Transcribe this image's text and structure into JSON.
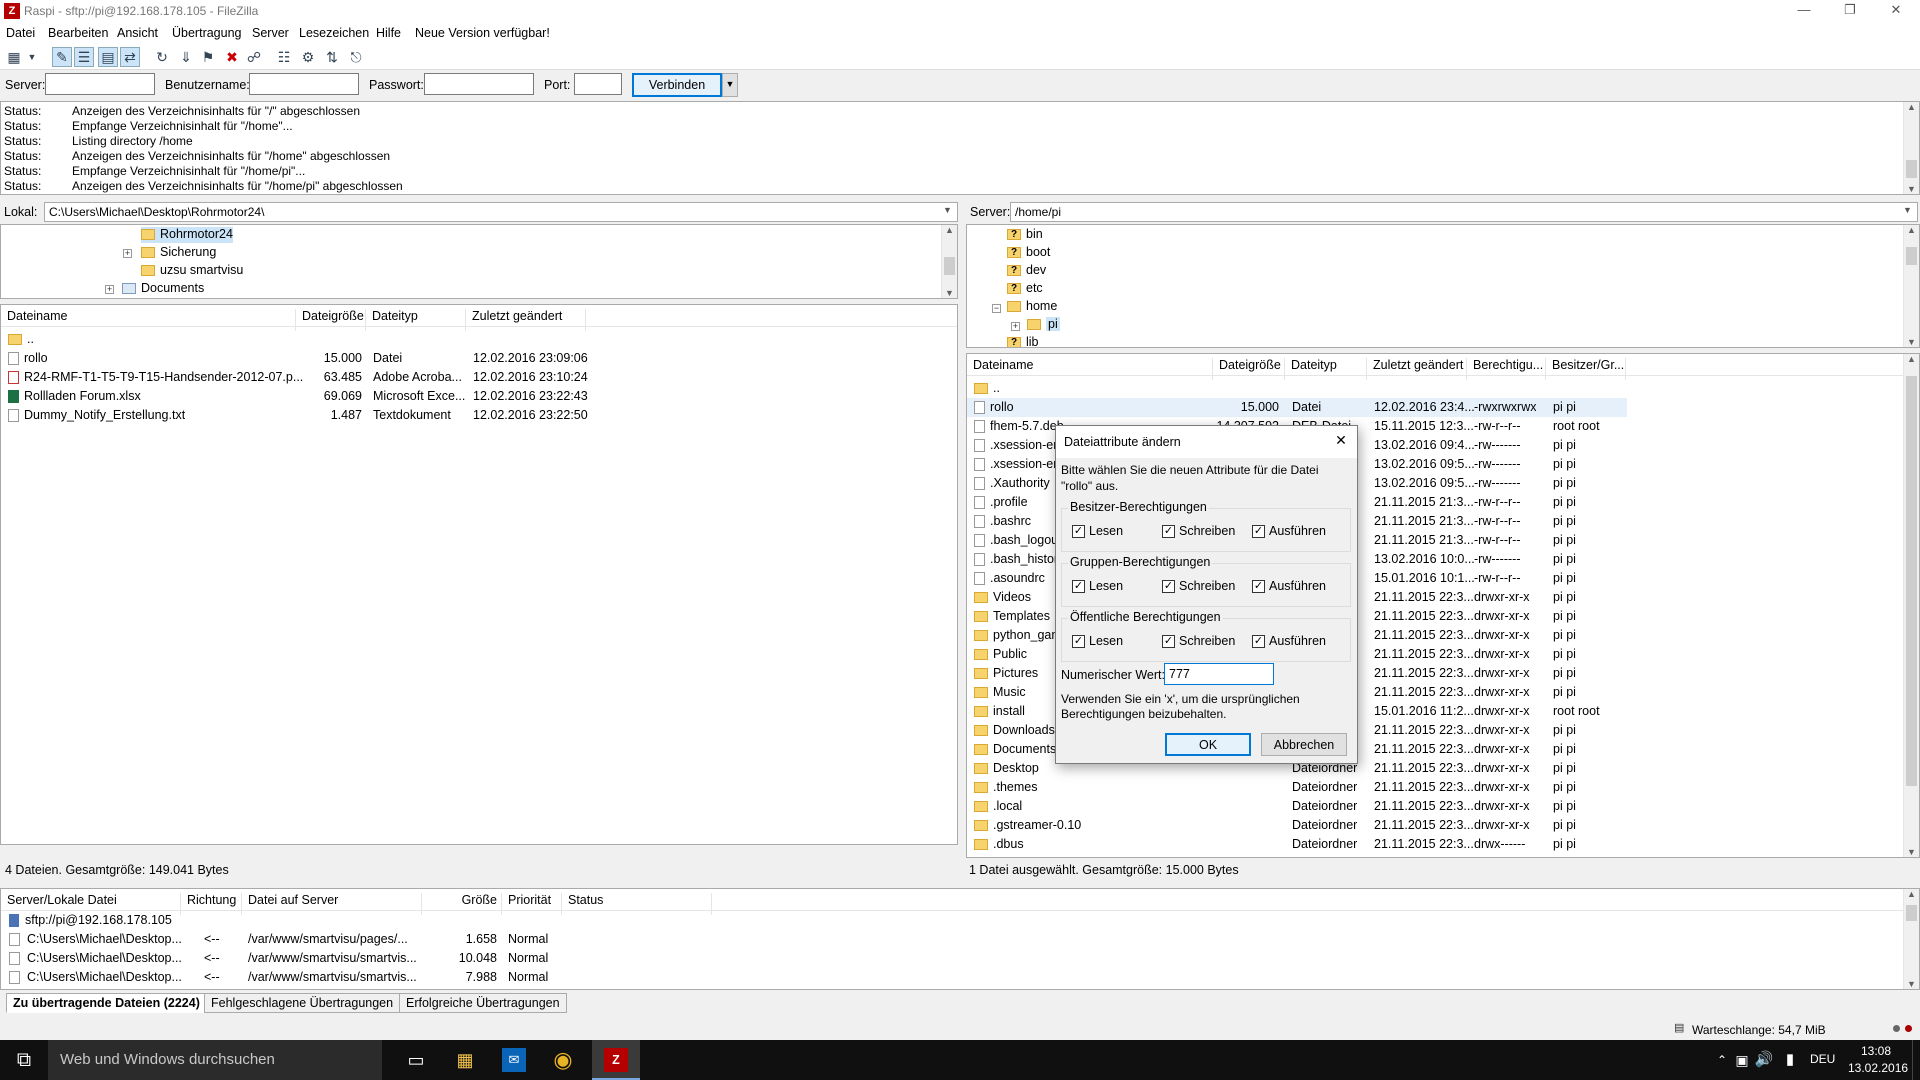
{
  "window": {
    "title": "Raspi - sftp://pi@192.168.178.105 - FileZilla",
    "app_icon": "Z"
  },
  "menu": [
    "Datei",
    "Bearbeiten",
    "Ansicht",
    "Übertragung",
    "Server",
    "Lesezeichen",
    "Hilfe",
    "Neue Version verfügbar!"
  ],
  "quickconnect": {
    "server_label": "Server:",
    "user_label": "Benutzername:",
    "pass_label": "Passwort:",
    "port_label": "Port:",
    "connect": "Verbinden",
    "server": "",
    "user": "",
    "pass": "",
    "port": ""
  },
  "log": [
    {
      "k": "Status:",
      "v": "Anzeigen des Verzeichnisinhalts für \"/\" abgeschlossen"
    },
    {
      "k": "Status:",
      "v": "Empfange Verzeichnisinhalt für \"/home\"..."
    },
    {
      "k": "Status:",
      "v": "Listing directory /home"
    },
    {
      "k": "Status:",
      "v": "Anzeigen des Verzeichnisinhalts für \"/home\" abgeschlossen"
    },
    {
      "k": "Status:",
      "v": "Empfange Verzeichnisinhalt für \"/home/pi\"..."
    },
    {
      "k": "Status:",
      "v": "Anzeigen des Verzeichnisinhalts für \"/home/pi\" abgeschlossen"
    }
  ],
  "local": {
    "label": "Lokal:",
    "path": "C:\\Users\\Michael\\Desktop\\Rohrmotor24\\",
    "tree": [
      "Rohrmotor24",
      "Sicherung",
      "uzsu smartvisu",
      "Documents"
    ],
    "headers": [
      "Dateiname",
      "Dateigröße",
      "Dateityp",
      "Zuletzt geändert"
    ],
    "files": [
      {
        "name": "..",
        "size": "",
        "type": "",
        "date": ""
      },
      {
        "name": "rollo",
        "size": "15.000",
        "type": "Datei",
        "date": "12.02.2016 23:09:06"
      },
      {
        "name": "R24-RMF-T1-T5-T9-T15-Handsender-2012-07.p...",
        "size": "63.485",
        "type": "Adobe Acroba...",
        "date": "12.02.2016 23:10:24"
      },
      {
        "name": "Rollladen Forum.xlsx",
        "size": "69.069",
        "type": "Microsoft Exce...",
        "date": "12.02.2016 23:22:43"
      },
      {
        "name": "Dummy_Notify_Erstellung.txt",
        "size": "1.487",
        "type": "Textdokument",
        "date": "12.02.2016 23:22:50"
      }
    ],
    "status": "4 Dateien. Gesamtgröße: 149.041 Bytes"
  },
  "remote": {
    "label": "Server:",
    "path": "/home/pi",
    "tree": [
      "bin",
      "boot",
      "dev",
      "etc",
      "home",
      "pi",
      "lib"
    ],
    "headers": [
      "Dateiname",
      "Dateigröße",
      "Dateityp",
      "Zuletzt geändert",
      "Berechtigu...",
      "Besitzer/Gr..."
    ],
    "files": [
      {
        "name": "..",
        "size": "",
        "type": "",
        "date": "",
        "perm": "",
        "owner": ""
      },
      {
        "name": "rollo",
        "size": "15.000",
        "type": "Datei",
        "date": "12.02.2016 23:4...",
        "perm": "-rwxrwxrwx",
        "owner": "pi pi"
      },
      {
        "name": "fhem-5.7.deb",
        "size": "14.307.592",
        "type": "DEB-Datei",
        "date": "15.11.2015 12:3...",
        "perm": "-rw-r--r--",
        "owner": "root root"
      },
      {
        "name": ".xsession-errors",
        "size": "",
        "type": "",
        "date": "13.02.2016 09:4...",
        "perm": "-rw-------",
        "owner": "pi pi"
      },
      {
        "name": ".xsession-errors",
        "size": "",
        "type": "",
        "date": "13.02.2016 09:5...",
        "perm": "-rw-------",
        "owner": "pi pi"
      },
      {
        "name": ".Xauthority",
        "size": "",
        "type": "",
        "date": "13.02.2016 09:5...",
        "perm": "-rw-------",
        "owner": "pi pi"
      },
      {
        "name": ".profile",
        "size": "",
        "type": "",
        "date": "21.11.2015 21:3...",
        "perm": "-rw-r--r--",
        "owner": "pi pi"
      },
      {
        "name": ".bashrc",
        "size": "",
        "type": "",
        "date": "21.11.2015 21:3...",
        "perm": "-rw-r--r--",
        "owner": "pi pi"
      },
      {
        "name": ".bash_logout",
        "size": "",
        "type": "",
        "date": "21.11.2015 21:3...",
        "perm": "-rw-r--r--",
        "owner": "pi pi"
      },
      {
        "name": ".bash_history",
        "size": "",
        "type": "",
        "date": "13.02.2016 10:0...",
        "perm": "-rw-------",
        "owner": "pi pi"
      },
      {
        "name": ".asoundrc",
        "size": "",
        "type": "",
        "date": "15.01.2016 10:1...",
        "perm": "-rw-r--r--",
        "owner": "pi pi"
      },
      {
        "name": "Videos",
        "size": "",
        "type": "",
        "date": "21.11.2015 22:3...",
        "perm": "drwxr-xr-x",
        "owner": "pi pi"
      },
      {
        "name": "Templates",
        "size": "",
        "type": "",
        "date": "21.11.2015 22:3...",
        "perm": "drwxr-xr-x",
        "owner": "pi pi"
      },
      {
        "name": "python_games",
        "size": "",
        "type": "",
        "date": "21.11.2015 22:3...",
        "perm": "drwxr-xr-x",
        "owner": "pi pi"
      },
      {
        "name": "Public",
        "size": "",
        "type": "",
        "date": "21.11.2015 22:3...",
        "perm": "drwxr-xr-x",
        "owner": "pi pi"
      },
      {
        "name": "Pictures",
        "size": "",
        "type": "",
        "date": "21.11.2015 22:3...",
        "perm": "drwxr-xr-x",
        "owner": "pi pi"
      },
      {
        "name": "Music",
        "size": "",
        "type": "",
        "date": "21.11.2015 22:3...",
        "perm": "drwxr-xr-x",
        "owner": "pi pi"
      },
      {
        "name": "install",
        "size": "",
        "type": "",
        "date": "15.01.2016 11:2...",
        "perm": "drwxr-xr-x",
        "owner": "root root"
      },
      {
        "name": "Downloads",
        "size": "",
        "type": "",
        "date": "21.11.2015 22:3...",
        "perm": "drwxr-xr-x",
        "owner": "pi pi"
      },
      {
        "name": "Documents",
        "size": "",
        "type": "",
        "date": "21.11.2015 22:3...",
        "perm": "drwxr-xr-x",
        "owner": "pi pi"
      },
      {
        "name": "Desktop",
        "size": "",
        "type": "Dateiordner",
        "date": "21.11.2015 22:3...",
        "perm": "drwxr-xr-x",
        "owner": "pi pi"
      },
      {
        "name": ".themes",
        "size": "",
        "type": "Dateiordner",
        "date": "21.11.2015 22:3...",
        "perm": "drwxr-xr-x",
        "owner": "pi pi"
      },
      {
        "name": ".local",
        "size": "",
        "type": "Dateiordner",
        "date": "21.11.2015 22:3...",
        "perm": "drwxr-xr-x",
        "owner": "pi pi"
      },
      {
        "name": ".gstreamer-0.10",
        "size": "",
        "type": "Dateiordner",
        "date": "21.11.2015 22:3...",
        "perm": "drwxr-xr-x",
        "owner": "pi pi"
      },
      {
        "name": ".dbus",
        "size": "",
        "type": "Dateiordner",
        "date": "21.11.2015 22:3...",
        "perm": "drwx------",
        "owner": "pi pi"
      }
    ],
    "status": "1 Datei ausgewählt. Gesamtgröße: 15.000 Bytes"
  },
  "queue": {
    "headers": [
      "Server/Lokale Datei",
      "Richtung",
      "Datei auf Server",
      "Größe",
      "Priorität",
      "Status"
    ],
    "server": "sftp://pi@192.168.178.105",
    "rows": [
      {
        "local": "C:\\Users\\Michael\\Desktop...",
        "dir": "<--",
        "remote": "/var/www/smartvisu/pages/...",
        "size": "1.658",
        "prio": "Normal"
      },
      {
        "local": "C:\\Users\\Michael\\Desktop...",
        "dir": "<--",
        "remote": "/var/www/smartvisu/smartvis...",
        "size": "10.048",
        "prio": "Normal"
      },
      {
        "local": "C:\\Users\\Michael\\Desktop...",
        "dir": "<--",
        "remote": "/var/www/smartvisu/smartvis...",
        "size": "7.988",
        "prio": "Normal"
      }
    ],
    "tabs": [
      "Zu übertragende Dateien (2224)",
      "Fehlgeschlagene Übertragungen",
      "Erfolgreiche Übertragungen"
    ],
    "footer": "Warteschlange: 54,7 MiB"
  },
  "dialog": {
    "title": "Dateiattribute ändern",
    "prompt": "Bitte wählen Sie die neuen Attribute für die Datei \"rollo\" aus.",
    "groups": [
      {
        "label": "Besitzer-Berechtigungen",
        "read": "Lesen",
        "write": "Schreiben",
        "exec": "Ausführen"
      },
      {
        "label": "Gruppen-Berechtigungen",
        "read": "Lesen",
        "write": "Schreiben",
        "exec": "Ausführen"
      },
      {
        "label": "Öffentliche Berechtigungen",
        "read": "Lesen",
        "write": "Schreiben",
        "exec": "Ausführen"
      }
    ],
    "numeric_label": "Numerischer Wert:",
    "numeric_value": "777",
    "hint": "Verwenden Sie ein 'x', um die ursprünglichen Berechtigungen beizubehalten.",
    "ok": "OK",
    "cancel": "Abbrechen"
  },
  "taskbar": {
    "search": "Web und Windows durchsuchen",
    "lang": "DEU",
    "time": "13:08",
    "date": "13.02.2016"
  }
}
